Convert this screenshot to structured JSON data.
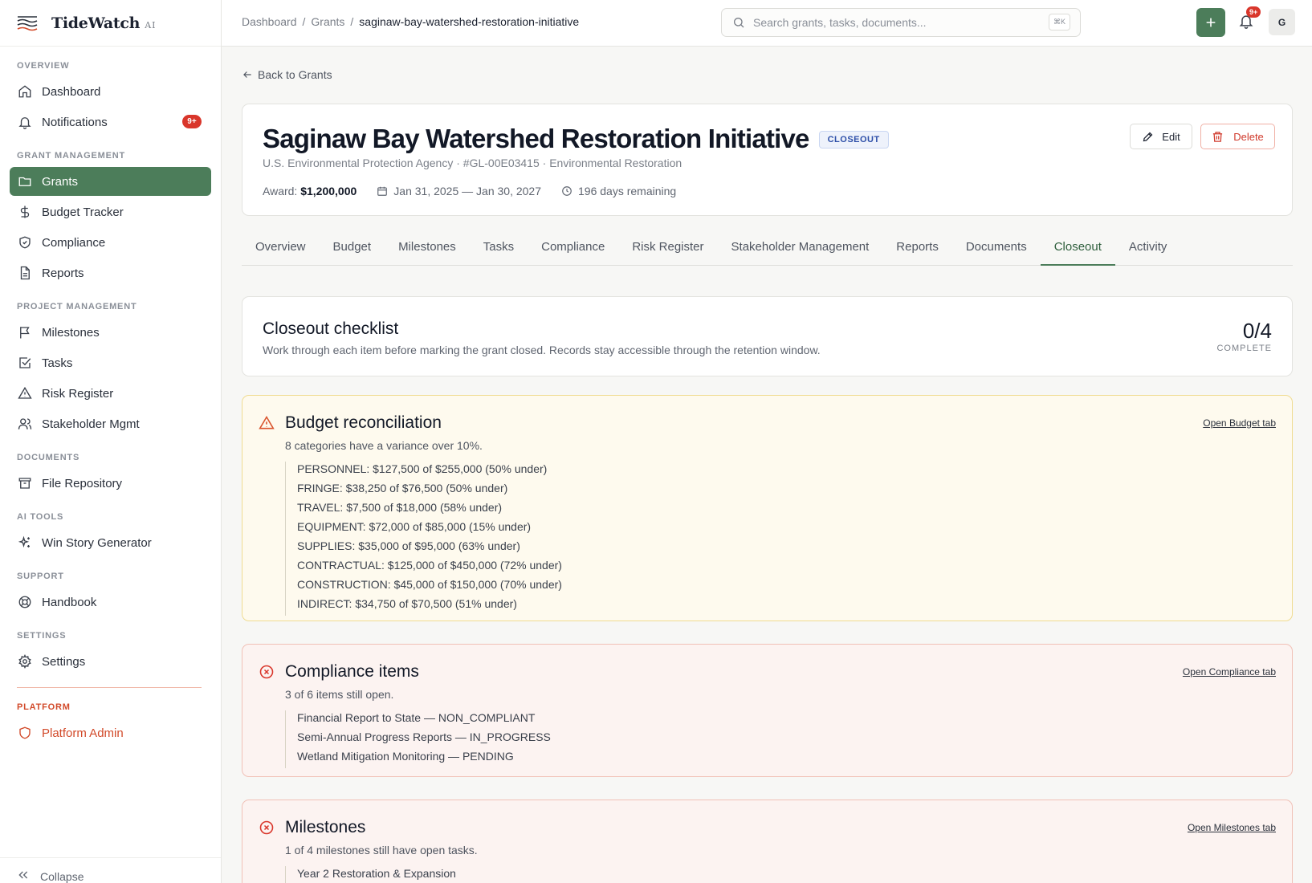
{
  "brand": {
    "name": "TideWatch",
    "suffix": "AI"
  },
  "sidebar": {
    "sections": {
      "overview": "OVERVIEW",
      "grant_mgmt": "GRANT MANAGEMENT",
      "project_mgmt": "PROJECT MANAGEMENT",
      "documents": "DOCUMENTS",
      "ai_tools": "AI TOOLS",
      "support": "SUPPORT",
      "settings": "SETTINGS",
      "platform": "PLATFORM"
    },
    "items": {
      "dashboard": "Dashboard",
      "notifications": "Notifications",
      "notifications_badge": "9+",
      "grants": "Grants",
      "budget_tracker": "Budget Tracker",
      "compliance": "Compliance",
      "reports": "Reports",
      "milestones": "Milestones",
      "tasks": "Tasks",
      "risk_register": "Risk Register",
      "stakeholder_mgmt": "Stakeholder Mgmt",
      "file_repository": "File Repository",
      "win_story": "Win Story Generator",
      "handbook": "Handbook",
      "settings": "Settings",
      "platform_admin": "Platform Admin"
    },
    "collapse": "Collapse"
  },
  "topbar": {
    "breadcrumb": [
      "Dashboard",
      "Grants",
      "saginaw-bay-watershed-restoration-initiative"
    ],
    "breadcrumb_sep": "/",
    "search_placeholder": "Search grants, tasks, documents...",
    "search_kbd": "⌘K",
    "notif_badge": "9+",
    "avatar_initial": "G"
  },
  "grant": {
    "back_label": "Back to Grants",
    "title": "Saginaw Bay Watershed Restoration Initiative",
    "status": "CLOSEOUT",
    "subtitle": "U.S. Environmental Protection Agency · #GL-00E03415 · Environmental Restoration",
    "award_label": "Award:",
    "award_value": "$1,200,000",
    "dates": "Jan 31, 2025 — Jan 30, 2027",
    "remaining": "196 days remaining",
    "edit_label": "Edit",
    "delete_label": "Delete"
  },
  "tabs": [
    "Overview",
    "Budget",
    "Milestones",
    "Tasks",
    "Compliance",
    "Risk Register",
    "Stakeholder Management",
    "Reports",
    "Documents",
    "Closeout",
    "Activity"
  ],
  "active_tab": "Closeout",
  "checklist": {
    "title": "Closeout checklist",
    "description": "Work through each item before marking the grant closed. Records stay accessible through the retention window.",
    "count": "0/4",
    "count_label": "COMPLETE"
  },
  "items": [
    {
      "status": "warning",
      "title": "Budget reconciliation",
      "description": "8 categories have a variance over 10%.",
      "link": "Open Budget tab",
      "lines": [
        "PERSONNEL: $127,500 of $255,000 (50% under)",
        "FRINGE: $38,250 of $76,500 (50% under)",
        "TRAVEL: $7,500 of $18,000 (58% under)",
        "EQUIPMENT: $72,000 of $85,000 (15% under)",
        "SUPPLIES: $35,000 of $95,000 (63% under)",
        "CONTRACTUAL: $125,000 of $450,000 (72% under)",
        "CONSTRUCTION: $45,000 of $150,000 (70% under)",
        "INDIRECT: $34,750 of $70,500 (51% under)"
      ]
    },
    {
      "status": "error",
      "title": "Compliance items",
      "description": "3 of 6 items still open.",
      "link": "Open Compliance tab",
      "lines": [
        "Financial Report to State — NON_COMPLIANT",
        "Semi-Annual Progress Reports — IN_PROGRESS",
        "Wetland Mitigation Monitoring — PENDING"
      ]
    },
    {
      "status": "error",
      "title": "Milestones",
      "description": "1 of 4 milestones still have open tasks.",
      "link": "Open Milestones tab",
      "lines": [
        "Year 2 Restoration & Expansion"
      ]
    }
  ],
  "colors": {
    "accent": "#4c7d5a",
    "danger": "#d9362b",
    "status_pill": "#2d4fa8",
    "warning_bg": "#fefaee",
    "error_bg": "#fcf3f1"
  }
}
